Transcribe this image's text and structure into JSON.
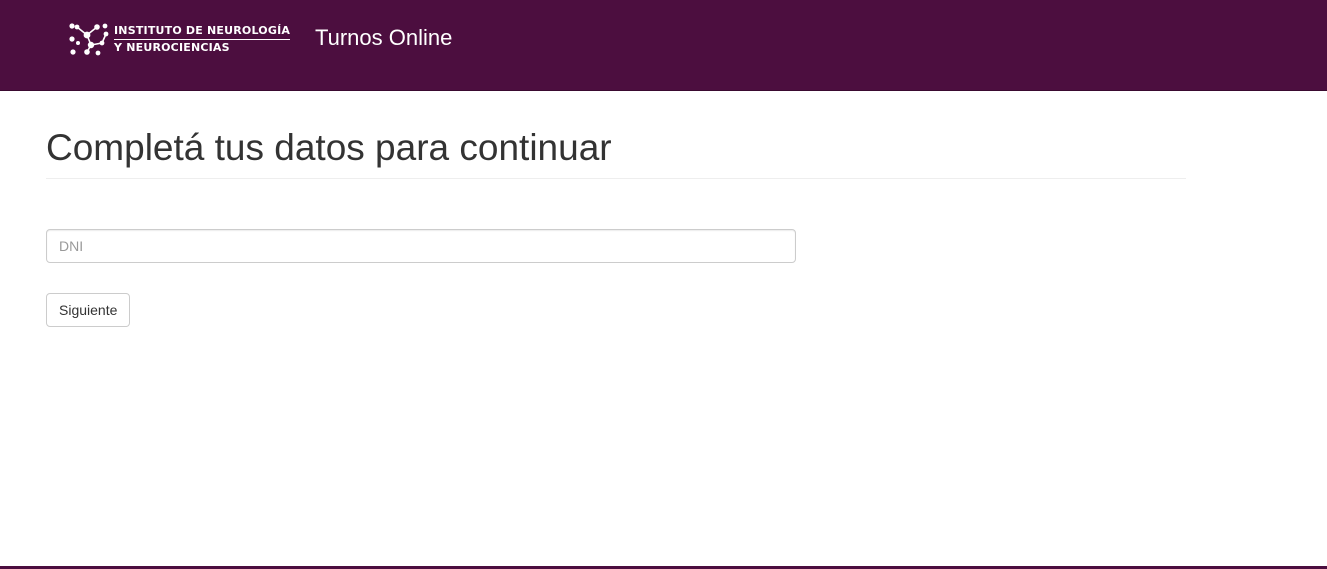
{
  "header": {
    "logo_line1": "INSTITUTO DE NEUROLOGÍA",
    "logo_line2": "Y NEUROCIENCIAS",
    "logo_icon": "neuron-network-icon",
    "brand": "Turnos Online",
    "background_color": "#4c0e3f"
  },
  "main": {
    "title": "Completá tus datos para continuar",
    "dni_field": {
      "placeholder": "DNI",
      "value": ""
    },
    "next_button_label": "Siguiente"
  }
}
